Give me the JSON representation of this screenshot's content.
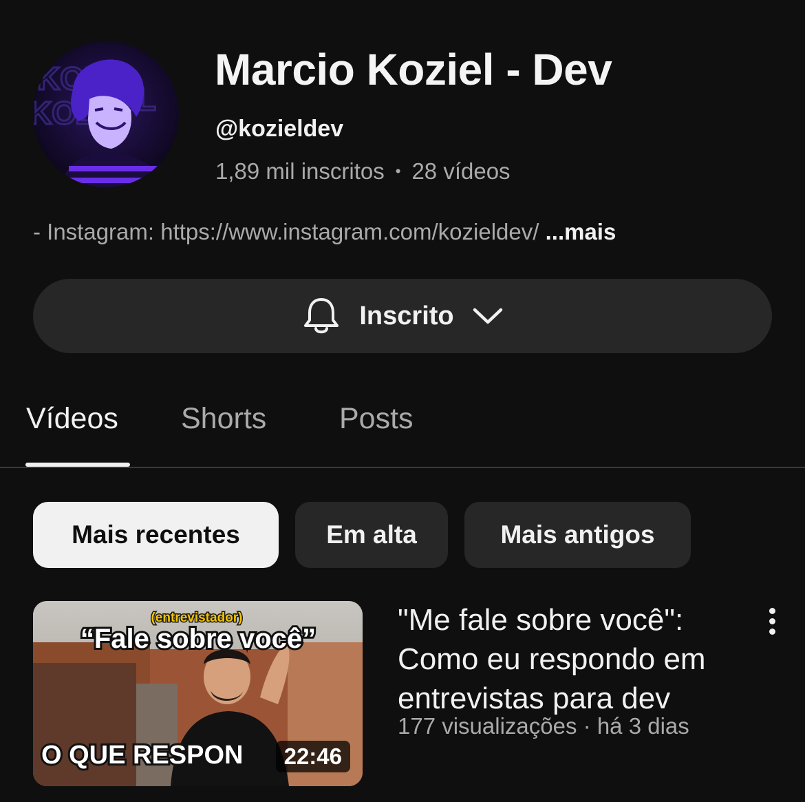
{
  "channel": {
    "name": "Marcio Koziel - Dev",
    "handle": "@kozieldev",
    "subscribers": "1,89 mil inscritos",
    "separator": "•",
    "video_count": "28 vídeos",
    "description": "- Instagram: https://www.instagram.com/kozieldev/",
    "more_label": "...mais",
    "avatar_icon": "channel-avatar"
  },
  "subscribe": {
    "label": "Inscrito",
    "bell_icon": "bell-icon",
    "dropdown_icon": "chevron-down-icon"
  },
  "tabs": [
    {
      "label": "Vídeos",
      "active": true
    },
    {
      "label": "Shorts",
      "active": false
    },
    {
      "label": "Posts",
      "active": false
    }
  ],
  "chips": [
    {
      "label": "Mais recentes",
      "selected": true
    },
    {
      "label": "Em alta",
      "selected": false
    },
    {
      "label": "Mais antigos",
      "selected": false
    }
  ],
  "video": {
    "title": "\"Me fale sobre você\": Como eu respondo em entrevistas para dev",
    "meta": "177 visualizações · há 3 dias",
    "duration": "22:46",
    "thumb_small": "(entrevistador)",
    "thumb_headline": "“Fale sobre você”",
    "thumb_bottom": "O QUE RESPON",
    "menu_icon": "more-vert-icon"
  },
  "colors": {
    "background": "#0f0f0f",
    "surface": "#272727",
    "text_primary": "#f1f1f1",
    "text_secondary": "#aaaaaa",
    "avatar_accent": "#6a2ee8"
  }
}
